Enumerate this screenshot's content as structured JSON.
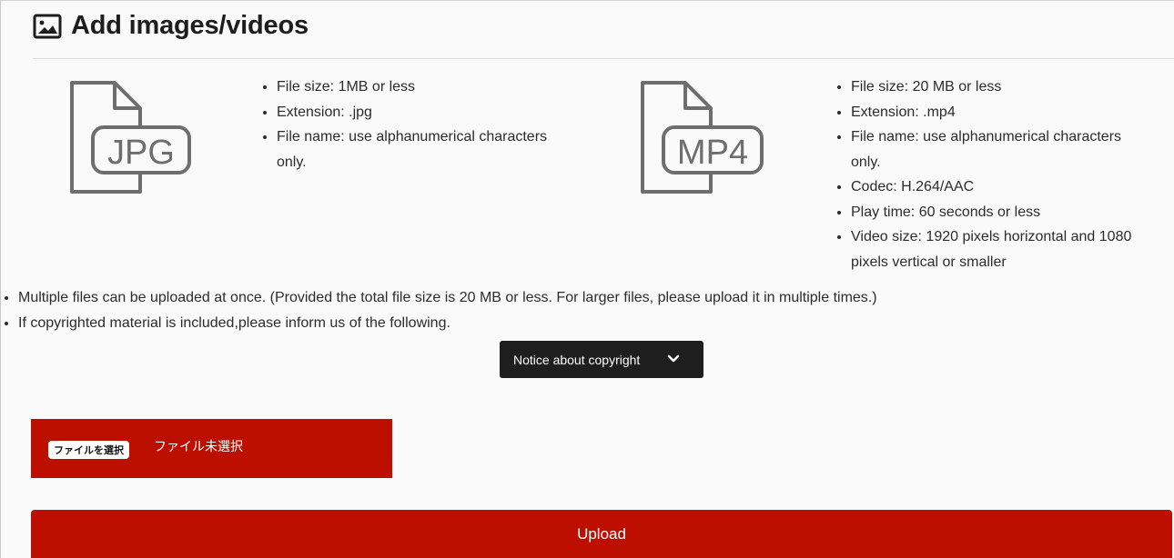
{
  "heading": {
    "title": "Add images/videos",
    "icon": "image-icon"
  },
  "image_spec": {
    "icon_label": "JPG",
    "items": [
      "File size: 1MB or less",
      "Extension: .jpg",
      "File name: use alphanumerical characters only."
    ]
  },
  "video_spec": {
    "icon_label": "MP4",
    "items": [
      "File size: 20 MB or less",
      "Extension: .mp4",
      "File name: use alphanumerical characters only.",
      "Codec: H.264/AAC",
      "Play time: 60 seconds or less",
      "Video size: 1920 pixels horizontal and 1080 pixels vertical or smaller"
    ]
  },
  "notes": [
    "Multiple files can be uploaded at once. (Provided the total file size is 20 MB or less. For larger files, please upload it in multiple times.)",
    "If copyrighted material is included,please inform us of the following."
  ],
  "copyright_dropdown": {
    "label": "Notice about copyright",
    "icon": "chevron-down-icon"
  },
  "file_input": {
    "button_label": "ファイルを選択",
    "status": "ファイル未選択"
  },
  "upload": {
    "label": "Upload"
  },
  "colors": {
    "accent": "#bd0f00",
    "dark_button": "#1e1e1e",
    "icon_gray": "#6e6e6e"
  }
}
